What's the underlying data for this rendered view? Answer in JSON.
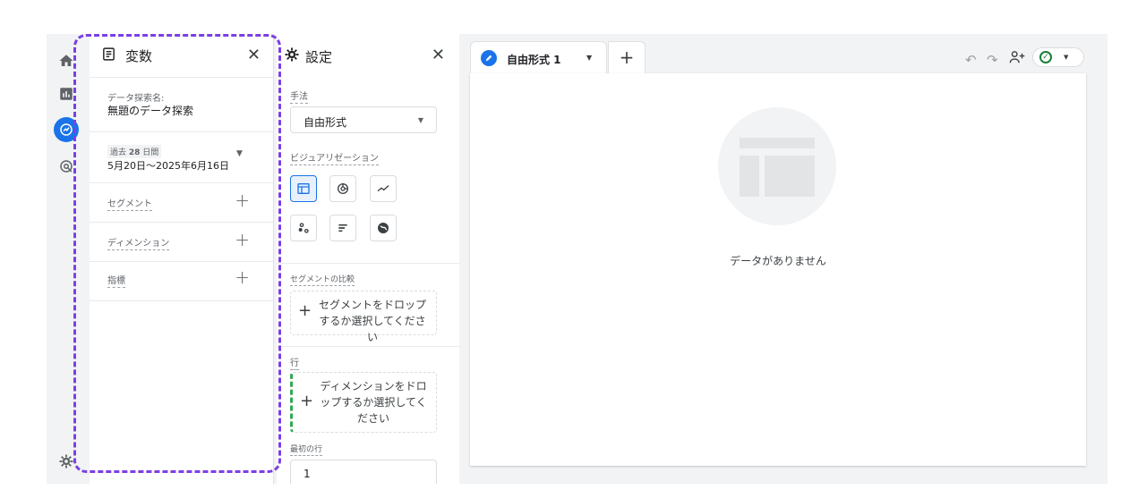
{
  "variables_panel": {
    "title": "変数",
    "exploration_name_label": "データ探索名:",
    "exploration_name": "無題のデータ探索",
    "date_range_prefix": "過去",
    "date_range_days": "28",
    "date_range_suffix": "日間",
    "date_range": "5月20日～2025年6月16日",
    "segments_label": "セグメント",
    "dimensions_label": "ディメンション",
    "metrics_label": "指標"
  },
  "settings_panel": {
    "title": "設定",
    "technique_label": "手法",
    "technique_value": "自由形式",
    "visualization_label": "ビジュアリゼーション",
    "visualization_icons": [
      "table-icon",
      "donut-chart-icon",
      "line-chart-icon",
      "scatter-plot-icon",
      "bar-chart-icon",
      "geo-map-icon"
    ],
    "segment_comparison_label": "セグメントの比較",
    "segment_drop_text": "セグメントをドロップするか選択してください",
    "rows_label": "行",
    "rows_drop_text": "ディメンションをドロップするか選択してください",
    "first_row_label": "最初の行",
    "first_row_value": "1"
  },
  "canvas": {
    "tab_label": "自由形式 1",
    "empty_message": "データがありません"
  },
  "colors": {
    "accent": "#1a73e8",
    "highlight_outline": "#7b3fe4",
    "status_green": "#188038",
    "rows_drop_border": "#34a853"
  }
}
